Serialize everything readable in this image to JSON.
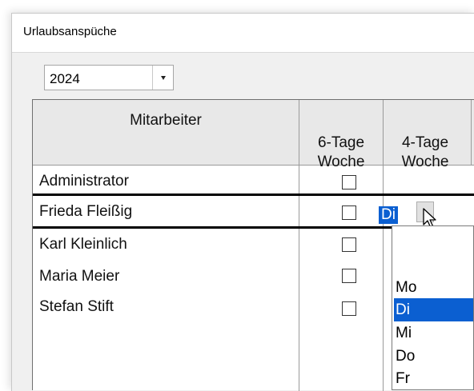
{
  "window": {
    "title": "Urlaubsanspüche"
  },
  "year_selector": {
    "value": "2024"
  },
  "table": {
    "columns": [
      "Mitarbeiter",
      "6-Tage\nWoche",
      "4-Tage\nWoche"
    ],
    "rows": [
      {
        "name": "Administrator",
        "six_day_week": false,
        "four_day_week": ""
      },
      {
        "name": "Frieda Fleißig",
        "six_day_week": false,
        "four_day_week": "Di"
      },
      {
        "name": "Karl Kleinlich",
        "six_day_week": false,
        "four_day_week": ""
      },
      {
        "name": "Maria Meier",
        "six_day_week": false,
        "four_day_week": ""
      },
      {
        "name": "Stefan Stift",
        "six_day_week": false,
        "four_day_week": ""
      }
    ]
  },
  "dropdown": {
    "options": [
      "",
      "Mo",
      "Di",
      "Mi",
      "Do",
      "Fr"
    ],
    "selected": "Di"
  },
  "colors": {
    "selection": "#0b5fd1",
    "header_bg": "#e8e8e8",
    "window_bg": "#f0f0f0"
  },
  "icons": {
    "year_dropdown": "caret-down-icon",
    "cell_dropdown": "chevron-down-icon",
    "cursor": "mouse-pointer-icon"
  }
}
